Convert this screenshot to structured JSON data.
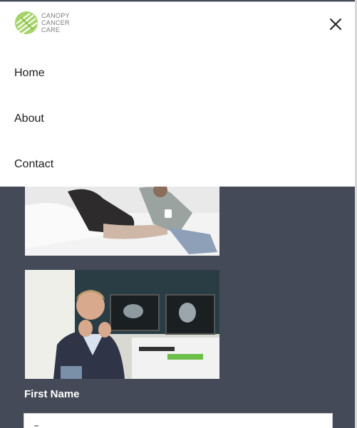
{
  "header": {
    "logo_lines": [
      "CANOPY",
      "CANCER",
      "CARE"
    ],
    "close_icon": "close-icon"
  },
  "menu": {
    "items": [
      {
        "label": "Home"
      },
      {
        "label": "About"
      },
      {
        "label": "Contact"
      }
    ]
  },
  "content": {
    "images": [
      {
        "description_icon": "photo-people-on-couch"
      },
      {
        "description_icon": "photo-doctor-at-monitors"
      }
    ],
    "form": {
      "first_name_label": "First Name",
      "first_name_value": ""
    }
  },
  "colors": {
    "page_background": "#454a58",
    "menu_background": "#ffffff",
    "logo_green": "#8cc63f",
    "text_dark": "#1d1d1d"
  }
}
